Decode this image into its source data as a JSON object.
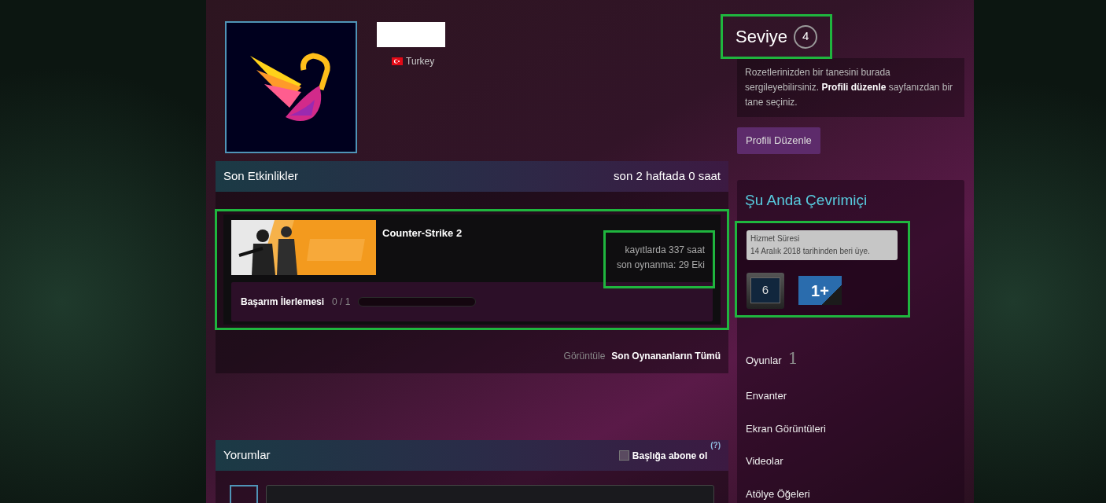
{
  "profile": {
    "name_redacted": true,
    "country": "Turkey"
  },
  "level_panel": {
    "title": "Seviye",
    "badge_number": "4",
    "highlighted": true
  },
  "badge_hint": "Rozetlerinizden bir tanesini burada sergileyebilirsiniz. **Profili düzenle** sayfanızdan bir tane seçiniz.",
  "edit_button": "Profili Düzenle",
  "recent_activity": {
    "title": "Son Etkinlikler",
    "summary": "son 2 haftada 0 saat",
    "games": [
      {
        "name": "Counter-Strike 2",
        "hours": "kayıtlarda 337 saat",
        "last_played": "son oynanma: 29 Eki",
        "highlighted": true,
        "stats_highlighted": true,
        "achievement_label": "Başarım İlerlemesi",
        "achievement_count": "0 / 1",
        "level": 0
      }
    ],
    "footer_label": "Görüntüle",
    "footer_link": "Son Oynananların Tümü"
  },
  "online": {
    "title": "Şu Anda Çevrimiçi",
    "highlighted": true,
    "tooltip_title": "Hizmet Süresi",
    "tooltip_text": "14 Aralık 2018 tarihinden beri üye.",
    "badges": [
      {
        "kind": "years",
        "label": "6"
      },
      {
        "kind": "games",
        "label": "1+"
      }
    ]
  },
  "links": [
    {
      "label": "Oyunlar",
      "count": "1"
    },
    {
      "label": "Envanter"
    },
    {
      "label": "Ekran Görüntüleri"
    },
    {
      "label": "Videolar"
    },
    {
      "label": "Atölye Öğeleri"
    }
  ],
  "comments": {
    "title": "Yorumlar",
    "subscribe_label": "Başlığa abone ol",
    "subscribed": false,
    "help": "(?)"
  }
}
